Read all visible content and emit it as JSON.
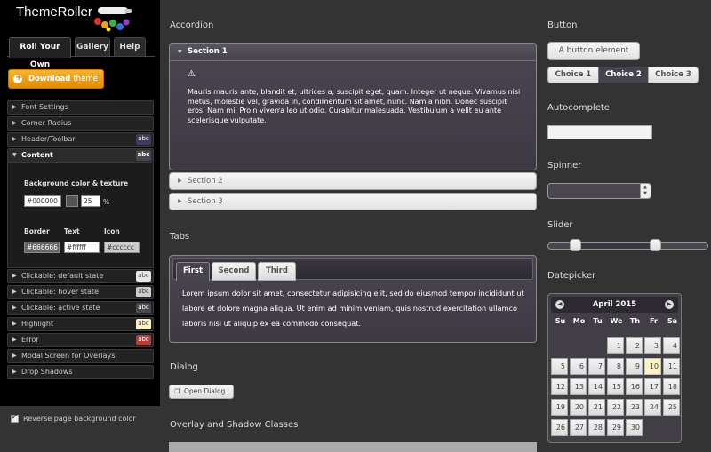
{
  "sidebar": {
    "logo": "ThemeRoller",
    "tabs": [
      "Roll Your Own",
      "Gallery",
      "Help"
    ],
    "download_label_bold": "Download",
    "download_label_light": "theme",
    "sections": [
      {
        "label": "Font Settings"
      },
      {
        "label": "Corner Radius"
      },
      {
        "label": "Header/Toolbar",
        "badge": "abc",
        "badge_bg": "#3d3d5c",
        "badge_fg": "#ffffff"
      },
      {
        "label": "Content",
        "badge": "abc",
        "badge_bg": "#4a4650",
        "badge_fg": "#ffffff"
      },
      {
        "label": "Clickable: default state",
        "badge": "abc",
        "badge_bg": "#e6e6e6",
        "badge_fg": "#555555"
      },
      {
        "label": "Clickable: hover state",
        "badge": "abc",
        "badge_bg": "#cccccc",
        "badge_fg": "#444444"
      },
      {
        "label": "Clickable: active state",
        "badge": "abc",
        "badge_bg": "#4a4650",
        "badge_fg": "#ffffff"
      },
      {
        "label": "Highlight",
        "badge": "abc",
        "badge_bg": "#fdf3c8",
        "badge_fg": "#444444"
      },
      {
        "label": "Error",
        "badge": "abc",
        "badge_bg": "#b33c3c",
        "badge_fg": "#ffffff"
      },
      {
        "label": "Modal Screen for Overlays"
      },
      {
        "label": "Drop Shadows"
      }
    ],
    "content": {
      "bg_label": "Background color & texture",
      "bg_color": "#000000",
      "opacity": "25",
      "opacity_unit": "%",
      "border_label": "Border",
      "text_label": "Text",
      "icon_label": "Icon",
      "border_value": "#666666",
      "text_value": "#ffffff",
      "icon_value": "#cccccc"
    },
    "reverse_label": "Reverse page background color"
  },
  "main": {
    "accordion_heading": "Accordion",
    "accordion": [
      {
        "label": "Section 1",
        "text": "Mauris mauris ante, blandit et, ultrices a, suscipit eget, quam. Integer ut neque. Vivamus nisi metus, molestie vel, gravida in, condimentum sit amet, nunc. Nam a nibh. Donec suscipit eros. Nam mi. Proin viverra leo ut odio. Curabitur malesuada. Vestibulum a velit eu ante scelerisque vulputate."
      },
      {
        "label": "Section 2"
      },
      {
        "label": "Section 3"
      }
    ],
    "tabs_heading": "Tabs",
    "tabs": [
      "First",
      "Second",
      "Third"
    ],
    "tabs_text": "Lorem ipsum dolor sit amet, consectetur adipisicing elit, sed do eiusmod tempor incididunt ut labore et dolore magna aliqua. Ut enim ad minim veniam, quis nostrud exercitation ullamco laboris nisi ut aliquip ex ea commodo consequat.",
    "dialog_heading": "Dialog",
    "dialog_button": "Open Dialog",
    "overlay_heading": "Overlay and Shadow Classes"
  },
  "right": {
    "button_heading": "Button",
    "button_label": "A button element",
    "choices": [
      "Choice 1",
      "Choice 2",
      "Choice 3"
    ],
    "autocomplete_heading": "Autocomplete",
    "spinner_heading": "Spinner",
    "slider_heading": "Slider",
    "slider_values": [
      0.17,
      0.67
    ],
    "datepicker_heading": "Datepicker",
    "datepicker": {
      "title": "April 2015",
      "weekdays": [
        "Su",
        "Mo",
        "Tu",
        "We",
        "Th",
        "Fr",
        "Sa"
      ],
      "first_weekday_index": 3,
      "days_in_month": 30,
      "today": 10
    }
  }
}
